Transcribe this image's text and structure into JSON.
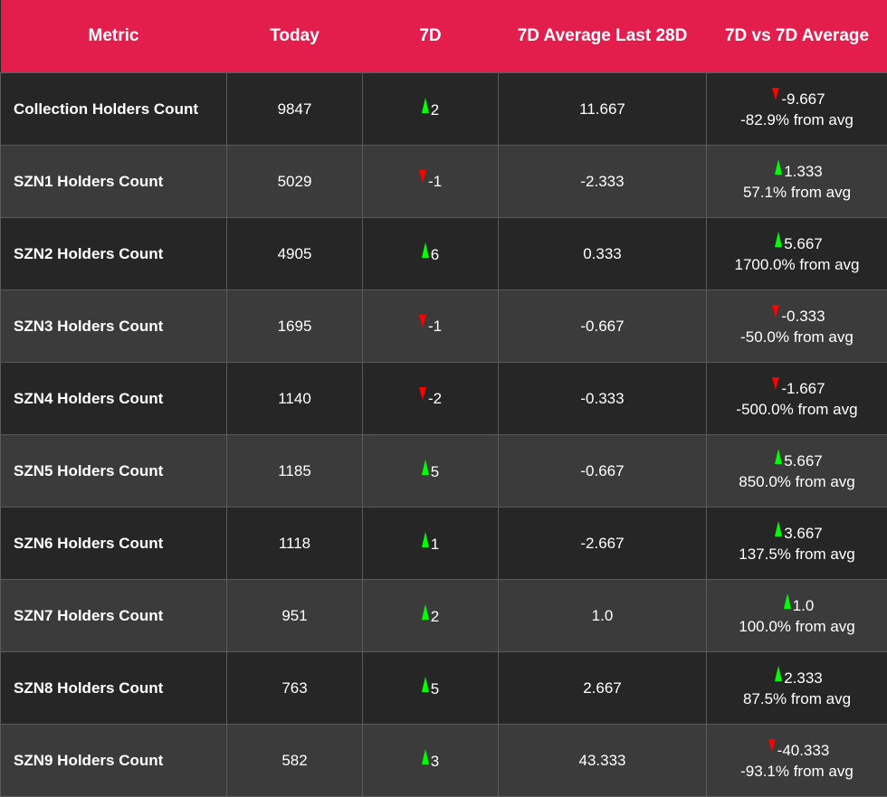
{
  "header": {
    "metric": "Metric",
    "today": "Today",
    "d7": "7D",
    "avg28": "7D Average Last 28D",
    "vs": "7D vs 7D Average"
  },
  "colors": {
    "header_bg": "#e31e4d",
    "row_dark": "#262626",
    "row_light": "#3b3b3b",
    "up": "#00ff00",
    "down": "#ff0000"
  },
  "rows": [
    {
      "metric": "Collection Holders Count",
      "today": "9847",
      "d7_dir": "up",
      "d7": "2",
      "avg": "11.667",
      "vs_dir": "down",
      "vs": "-9.667",
      "pct": "-82.9% from avg"
    },
    {
      "metric": "SZN1 Holders Count",
      "today": "5029",
      "d7_dir": "down",
      "d7": "-1",
      "avg": "-2.333",
      "vs_dir": "up",
      "vs": "1.333",
      "pct": "57.1% from avg"
    },
    {
      "metric": "SZN2 Holders Count",
      "today": "4905",
      "d7_dir": "up",
      "d7": "6",
      "avg": "0.333",
      "vs_dir": "up",
      "vs": "5.667",
      "pct": "1700.0% from avg"
    },
    {
      "metric": "SZN3 Holders Count",
      "today": "1695",
      "d7_dir": "down",
      "d7": "-1",
      "avg": "-0.667",
      "vs_dir": "down",
      "vs": "-0.333",
      "pct": "-50.0% from avg"
    },
    {
      "metric": "SZN4 Holders Count",
      "today": "1140",
      "d7_dir": "down",
      "d7": "-2",
      "avg": "-0.333",
      "vs_dir": "down",
      "vs": "-1.667",
      "pct": "-500.0% from avg"
    },
    {
      "metric": "SZN5 Holders Count",
      "today": "1185",
      "d7_dir": "up",
      "d7": "5",
      "avg": "-0.667",
      "vs_dir": "up",
      "vs": "5.667",
      "pct": "850.0% from avg"
    },
    {
      "metric": "SZN6 Holders Count",
      "today": "1118",
      "d7_dir": "up",
      "d7": "1",
      "avg": "-2.667",
      "vs_dir": "up",
      "vs": "3.667",
      "pct": "137.5% from avg"
    },
    {
      "metric": "SZN7 Holders Count",
      "today": "951",
      "d7_dir": "up",
      "d7": "2",
      "avg": "1.0",
      "vs_dir": "up",
      "vs": "1.0",
      "pct": "100.0% from avg"
    },
    {
      "metric": "SZN8 Holders Count",
      "today": "763",
      "d7_dir": "up",
      "d7": "5",
      "avg": "2.667",
      "vs_dir": "up",
      "vs": "2.333",
      "pct": "87.5% from avg"
    },
    {
      "metric": "SZN9 Holders Count",
      "today": "582",
      "d7_dir": "up",
      "d7": "3",
      "avg": "43.333",
      "vs_dir": "down",
      "vs": "-40.333",
      "pct": "-93.1% from avg"
    }
  ]
}
